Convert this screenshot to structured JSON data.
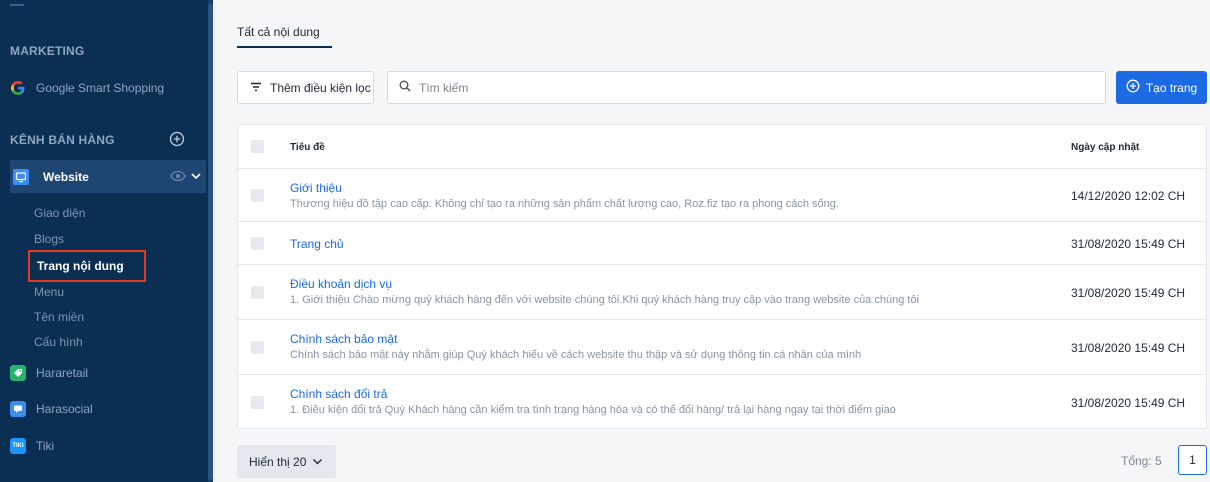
{
  "sidebar": {
    "marketing_title": "MARKETING",
    "google_label": "Google Smart Shopping",
    "channels_title": "KÊNH BÁN HÀNG",
    "website_label": "Website",
    "website_subitems": [
      "Giao diện",
      "Blogs",
      "Trang nội dung",
      "Menu",
      "Tên miền",
      "Cấu hình"
    ],
    "active_subitem": "Trang nội dung",
    "hararetail_label": "Hararetail",
    "harasocial_label": "Harasocial",
    "tiki_label": "Tiki",
    "tiki_icon_text": "TIKI"
  },
  "main": {
    "tab_all": "Tất cả nội dung",
    "filter_label": "Thêm điều kiện lọc",
    "search_placeholder": "Tìm kiếm",
    "create_label": "Tạo trang",
    "table": {
      "col_title": "Tiêu đề",
      "col_updated": "Ngày cập nhật",
      "rows": [
        {
          "title": "Giới thiệu",
          "desc": "Thương hiệu đồ tập cao cấp. Không chỉ tạo ra những sản phẩm chất lượng cao, Roz.fiz tạo ra phong cách sống.",
          "date": "14/12/2020 12:02 CH"
        },
        {
          "title": "Trang chủ",
          "desc": "",
          "date": "31/08/2020 15:49 CH"
        },
        {
          "title": "Điều khoản dịch vụ",
          "desc": "1. Giới thiệu Chào mừng quý khách hàng đến với website chúng tôi.Khi quý khách hàng truy cập vào trang website của chúng tôi",
          "date": "31/08/2020 15:49 CH"
        },
        {
          "title": "Chính sách bảo mật",
          "desc": "Chính sách bảo mật này nhằm giúp Quý khách hiểu về cách website thu thập và sử dụng thông tin cá nhân của mình",
          "date": "31/08/2020 15:49 CH"
        },
        {
          "title": "Chính sách đổi trả",
          "desc": "1. Điều kiện đổi trả Quý Khách hàng cần kiểm tra tình trạng hàng hóa và có thể đổi hàng/ trả lại hàng ngay tại thời điểm giao",
          "date": "31/08/2020 15:49 CH"
        }
      ]
    },
    "page_size_label": "Hiển thị 20",
    "total_label": "Tổng: 5",
    "current_page": "1"
  },
  "colors": {
    "sidebar_bg": "#0b2e53",
    "accent": "#1c6ae4",
    "highlight_border": "#e0391c"
  }
}
